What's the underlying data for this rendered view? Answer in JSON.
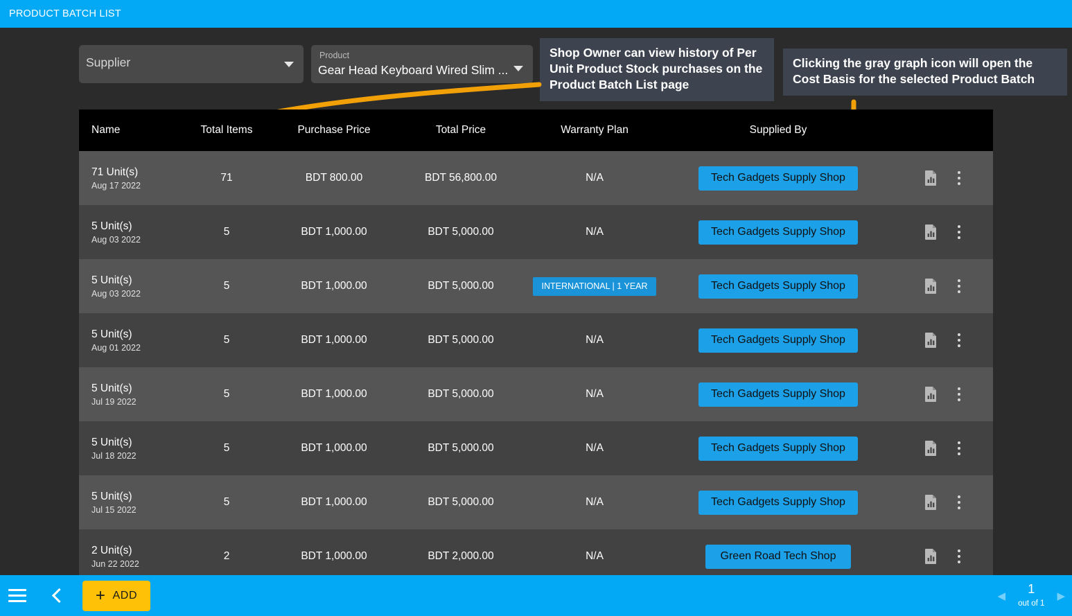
{
  "window": {
    "title": "PRODUCT BATCH LIST"
  },
  "colors": {
    "brand_blue": "#03a9f4",
    "accent_yellow": "#ffc107",
    "annotation_orange": "#f2a007",
    "callout_bg": "#3e444f",
    "row_odd": "#555555",
    "row_even": "#424242",
    "header_black": "#000000"
  },
  "filters": {
    "supplier": {
      "label": "Supplier",
      "value": "",
      "placeholder": "Supplier",
      "caret": "chevron-down-icon"
    },
    "product": {
      "label": "Product",
      "value": "Gear Head Keyboard Wired Slim ...",
      "caret": "chevron-down-icon"
    }
  },
  "annotations": [
    {
      "id": "history-note",
      "text": "Shop Owner can view history of Per Unit Product Stock purchases on the Product Batch List page"
    },
    {
      "id": "graph-icon-note",
      "text": "Clicking the gray graph icon will open the Cost Basis for the selected Product Batch"
    }
  ],
  "table": {
    "columns": [
      "Name",
      "Total Items",
      "Purchase Price",
      "Total Price",
      "Warranty Plan",
      "Supplied By"
    ],
    "rows": [
      {
        "name": "71 Unit(s)",
        "date": "Aug 17 2022",
        "items": "71",
        "purchase_price": "BDT 800.00",
        "total_price": "BDT 56,800.00",
        "warranty": "N/A",
        "warranty_is_chip": false,
        "supplier": "Tech Gadgets Supply Shop"
      },
      {
        "name": "5 Unit(s)",
        "date": "Aug 03 2022",
        "items": "5",
        "purchase_price": "BDT 1,000.00",
        "total_price": "BDT 5,000.00",
        "warranty": "N/A",
        "warranty_is_chip": false,
        "supplier": "Tech Gadgets Supply Shop"
      },
      {
        "name": "5 Unit(s)",
        "date": "Aug 03 2022",
        "items": "5",
        "purchase_price": "BDT 1,000.00",
        "total_price": "BDT 5,000.00",
        "warranty": "INTERNATIONAL | 1 YEAR",
        "warranty_is_chip": true,
        "supplier": "Tech Gadgets Supply Shop"
      },
      {
        "name": "5 Unit(s)",
        "date": "Aug 01 2022",
        "items": "5",
        "purchase_price": "BDT 1,000.00",
        "total_price": "BDT 5,000.00",
        "warranty": "N/A",
        "warranty_is_chip": false,
        "supplier": "Tech Gadgets Supply Shop"
      },
      {
        "name": "5 Unit(s)",
        "date": "Jul 19 2022",
        "items": "5",
        "purchase_price": "BDT 1,000.00",
        "total_price": "BDT 5,000.00",
        "warranty": "N/A",
        "warranty_is_chip": false,
        "supplier": "Tech Gadgets Supply Shop"
      },
      {
        "name": "5 Unit(s)",
        "date": "Jul 18 2022",
        "items": "5",
        "purchase_price": "BDT 1,000.00",
        "total_price": "BDT 5,000.00",
        "warranty": "N/A",
        "warranty_is_chip": false,
        "supplier": "Tech Gadgets Supply Shop"
      },
      {
        "name": "5 Unit(s)",
        "date": "Jul 15 2022",
        "items": "5",
        "purchase_price": "BDT 1,000.00",
        "total_price": "BDT 5,000.00",
        "warranty": "N/A",
        "warranty_is_chip": false,
        "supplier": "Tech Gadgets Supply Shop"
      },
      {
        "name": "2 Unit(s)",
        "date": "Jun 22 2022",
        "items": "2",
        "purchase_price": "BDT 1,000.00",
        "total_price": "BDT 2,000.00",
        "warranty": "N/A",
        "warranty_is_chip": false,
        "supplier": "Green Road Tech Shop"
      }
    ],
    "row_actions": {
      "chart_icon": "bar-chart-document-icon",
      "menu_icon": "more-vertical-icon"
    }
  },
  "bottombar": {
    "menu_icon": "hamburger-menu-icon",
    "back_icon": "chevron-left-icon",
    "add_label": "ADD",
    "add_plus": "+",
    "pagination": {
      "prev": "◀",
      "next": "▶",
      "current": "1",
      "out_of": "out of 1"
    }
  }
}
